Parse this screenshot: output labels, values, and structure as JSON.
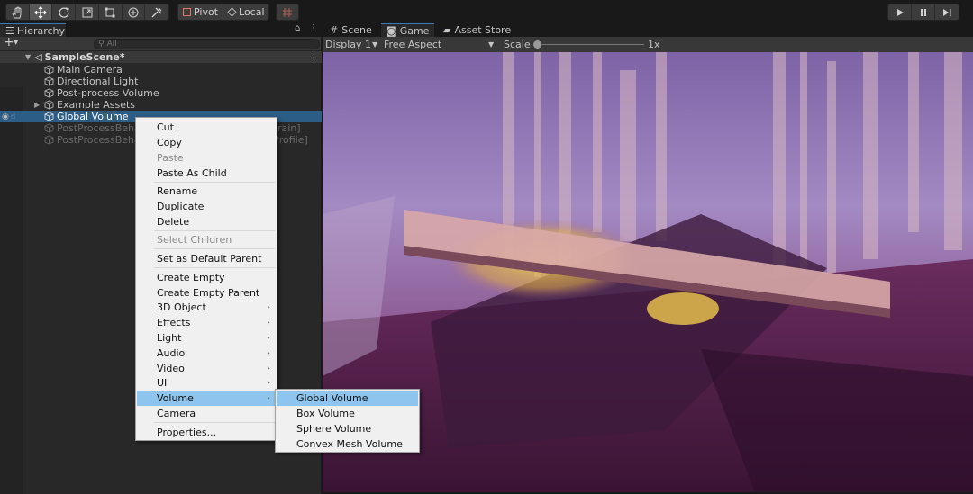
{
  "toolbar": {
    "tools": [
      "hand-tool-icon",
      "move-tool-icon",
      "rotate-tool-icon",
      "scale-tool-icon",
      "rect-tool-icon",
      "transform-tool-icon",
      "custom-tool-icon"
    ],
    "pivot_label": "Pivot",
    "local_label": "Local",
    "snap_icon": "grid-snap-icon"
  },
  "hierarchy": {
    "tab_label": "Hierarchy",
    "search_placeholder": "All",
    "scene_name": "SampleScene*",
    "items": [
      {
        "label": "Main Camera"
      },
      {
        "label": "Directional Light"
      },
      {
        "label": "Post-process Volume"
      },
      {
        "label": "Example Assets"
      },
      {
        "label": "Global Volume"
      },
      {
        "label": "PostProcessBehav"
      },
      {
        "label": "PostProcessBehav"
      }
    ],
    "row6_suffix": "rain]",
    "row7_suffix": "e Profile]"
  },
  "game": {
    "tabs": [
      {
        "label": "Scene"
      },
      {
        "label": "Game"
      },
      {
        "label": "Asset Store"
      }
    ],
    "display": "Display 1",
    "aspect": "Free Aspect",
    "scale_label": "Scale",
    "scale_value": "1x"
  },
  "context_menu": {
    "items": [
      "Cut",
      "Copy",
      "Paste",
      "Paste As Child",
      "Rename",
      "Duplicate",
      "Delete",
      "Select Children",
      "Set as Default Parent",
      "Create Empty",
      "Create Empty Parent",
      "3D Object",
      "Effects",
      "Light",
      "Audio",
      "Video",
      "UI",
      "Volume",
      "Camera",
      "Properties..."
    ]
  },
  "submenu": {
    "items": [
      "Global Volume",
      "Box Volume",
      "Sphere Volume",
      "Convex Mesh Volume"
    ]
  }
}
